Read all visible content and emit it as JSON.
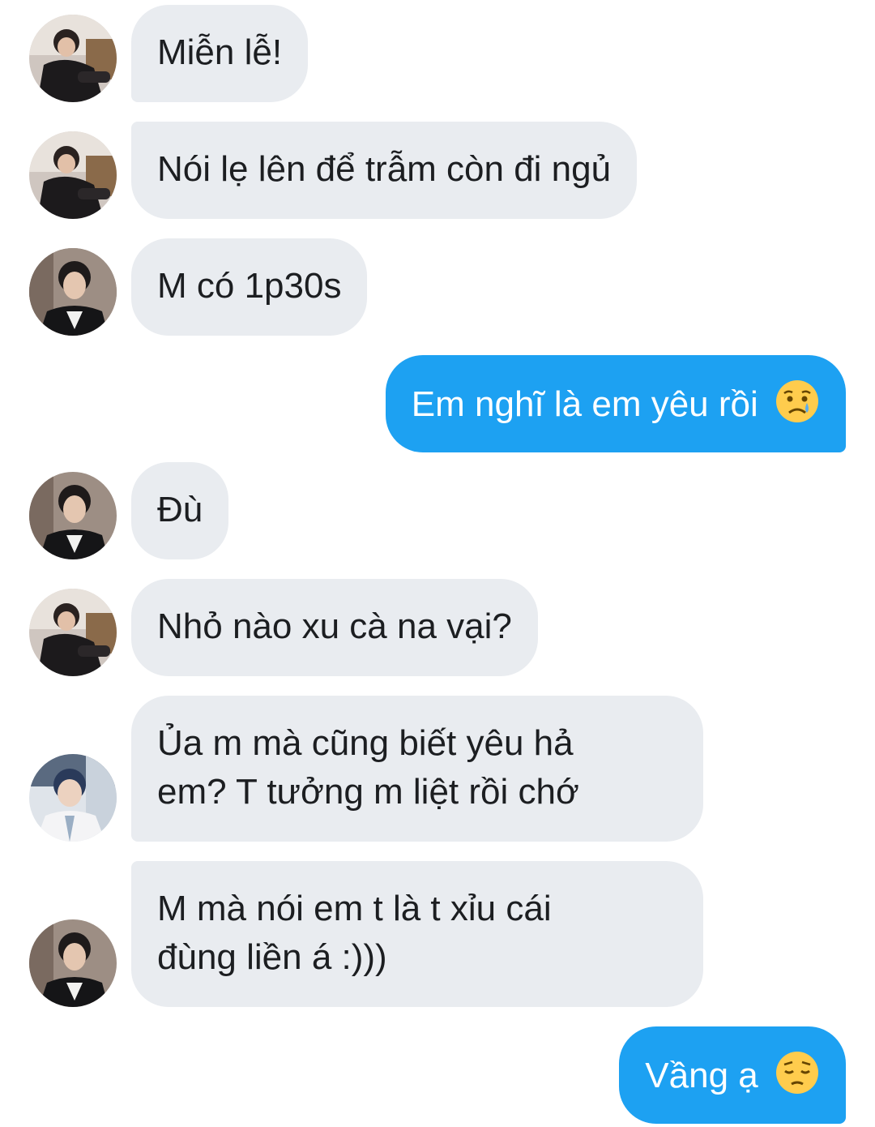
{
  "messages": [
    {
      "sender": "user-a",
      "direction": "incoming",
      "text": "Miễn lễ!"
    },
    {
      "sender": "user-a",
      "direction": "incoming",
      "text": "Nói lẹ lên để trẫm còn đi ngủ"
    },
    {
      "sender": "user-b",
      "direction": "incoming",
      "text": "M có 1p30s"
    },
    {
      "sender": "me",
      "direction": "outgoing",
      "text": "Em nghĩ là em yêu rồi",
      "emoji": "sad-relieved-face-emoji"
    },
    {
      "sender": "user-b",
      "direction": "incoming",
      "text": "Đù"
    },
    {
      "sender": "user-a",
      "direction": "incoming",
      "text": "Nhỏ nào xu cà na vại?"
    },
    {
      "sender": "user-c",
      "direction": "incoming",
      "lines": [
        "Ủa m mà cũng biết yêu hả",
        "em? T tưởng m liệt rồi chớ"
      ]
    },
    {
      "sender": "user-b",
      "direction": "incoming",
      "lines": [
        "M mà nói em t là t xỉu cái",
        "đùng liền á :)))"
      ]
    },
    {
      "sender": "me",
      "direction": "outgoing",
      "text": "Vầng ạ",
      "emoji": "pensive-face-emoji"
    }
  ],
  "colors": {
    "incoming_bubble": "#e9ecf0",
    "outgoing_bubble": "#1da1f2",
    "incoming_text": "#1c1e21",
    "outgoing_text": "#ffffff"
  }
}
